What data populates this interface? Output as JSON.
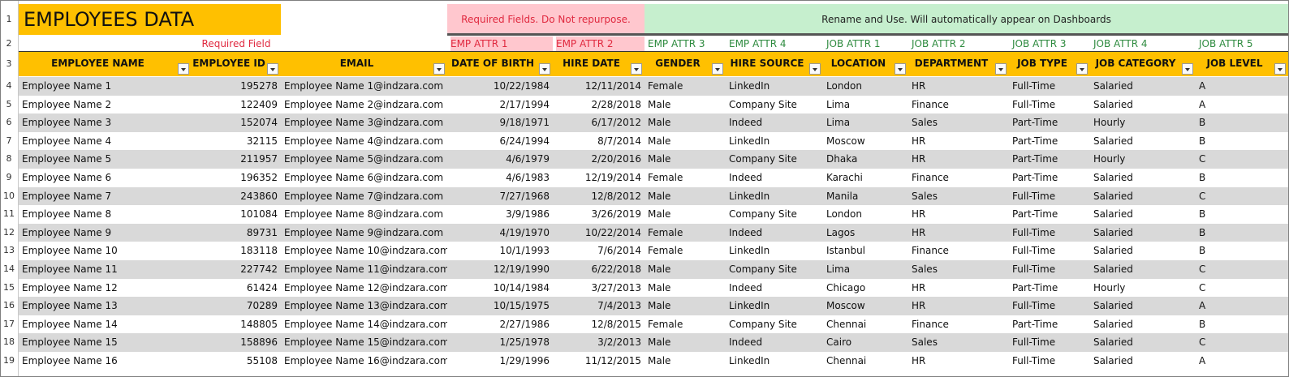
{
  "title": "EMPLOYEES DATA",
  "required_field_label": "Required Field",
  "banner_required": "Required Fields. Do Not repurpose.",
  "banner_rename": "Rename and Use. Will automatically appear on Dashboards",
  "colors": {
    "header_orange": "#ffc000",
    "required_pink": "#ffc7ce",
    "required_text": "#e0293f",
    "rename_green": "#c6efce",
    "green_text": "#2e8b3f",
    "row_gray": "#d9d9d9"
  },
  "icons": {
    "dropdown": "filter-dropdown-icon"
  },
  "attributes": [
    "EMP ATTR 1",
    "EMP ATTR 2",
    "EMP ATTR 3",
    "EMP ATTR 4",
    "JOB ATTR 1",
    "JOB ATTR 2",
    "JOB ATTR 3",
    "JOB ATTR 4",
    "JOB ATTR 5"
  ],
  "headers": [
    "EMPLOYEE NAME",
    "EMPLOYEE ID",
    "EMAIL",
    "DATE OF BIRTH",
    "HIRE DATE",
    "GENDER",
    "HIRE SOURCE",
    "LOCATION",
    "DEPARTMENT",
    "JOB TYPE",
    "JOB CATEGORY",
    "JOB LEVEL"
  ],
  "row_numbers": [
    "1",
    "2",
    "3",
    "4",
    "5",
    "6",
    "7",
    "8",
    "9",
    "10",
    "11",
    "12",
    "13",
    "14",
    "15",
    "16",
    "17",
    "18",
    "19"
  ],
  "rows": [
    [
      "Employee Name 1",
      "195278",
      "Employee Name 1@indzara.com",
      "10/22/1984",
      "12/11/2014",
      "Female",
      "LinkedIn",
      "London",
      "HR",
      "Full-Time",
      "Salaried",
      "A"
    ],
    [
      "Employee Name 2",
      "122409",
      "Employee Name 2@indzara.com",
      "2/17/1994",
      "2/28/2018",
      "Male",
      "Company Site",
      "Lima",
      "Finance",
      "Full-Time",
      "Salaried",
      "A"
    ],
    [
      "Employee Name 3",
      "152074",
      "Employee Name 3@indzara.com",
      "9/18/1971",
      "6/17/2012",
      "Male",
      "Indeed",
      "Lima",
      "Sales",
      "Part-Time",
      "Hourly",
      "B"
    ],
    [
      "Employee Name 4",
      "32115",
      "Employee Name 4@indzara.com",
      "6/24/1994",
      "8/7/2014",
      "Male",
      "LinkedIn",
      "Moscow",
      "HR",
      "Part-Time",
      "Salaried",
      "B"
    ],
    [
      "Employee Name 5",
      "211957",
      "Employee Name 5@indzara.com",
      "4/6/1979",
      "2/20/2016",
      "Male",
      "Company Site",
      "Dhaka",
      "HR",
      "Part-Time",
      "Hourly",
      "C"
    ],
    [
      "Employee Name 6",
      "196352",
      "Employee Name 6@indzara.com",
      "4/6/1983",
      "12/19/2014",
      "Female",
      "Indeed",
      "Karachi",
      "Finance",
      "Part-Time",
      "Salaried",
      "B"
    ],
    [
      "Employee Name 7",
      "243860",
      "Employee Name 7@indzara.com",
      "7/27/1968",
      "12/8/2012",
      "Male",
      "LinkedIn",
      "Manila",
      "Sales",
      "Full-Time",
      "Salaried",
      "C"
    ],
    [
      "Employee Name 8",
      "101084",
      "Employee Name 8@indzara.com",
      "3/9/1986",
      "3/26/2019",
      "Male",
      "Company Site",
      "London",
      "HR",
      "Part-Time",
      "Salaried",
      "B"
    ],
    [
      "Employee Name 9",
      "89731",
      "Employee Name 9@indzara.com",
      "4/19/1970",
      "10/22/2014",
      "Female",
      "Indeed",
      "Lagos",
      "HR",
      "Full-Time",
      "Salaried",
      "B"
    ],
    [
      "Employee Name 10",
      "183118",
      "Employee Name 10@indzara.com",
      "10/1/1993",
      "7/6/2014",
      "Female",
      "LinkedIn",
      "Istanbul",
      "Finance",
      "Full-Time",
      "Salaried",
      "B"
    ],
    [
      "Employee Name 11",
      "227742",
      "Employee Name 11@indzara.com",
      "12/19/1990",
      "6/22/2018",
      "Male",
      "Company Site",
      "Lima",
      "Sales",
      "Full-Time",
      "Salaried",
      "C"
    ],
    [
      "Employee Name 12",
      "61424",
      "Employee Name 12@indzara.com",
      "10/14/1984",
      "3/27/2013",
      "Male",
      "Indeed",
      "Chicago",
      "HR",
      "Part-Time",
      "Hourly",
      "C"
    ],
    [
      "Employee Name 13",
      "70289",
      "Employee Name 13@indzara.com",
      "10/15/1975",
      "7/4/2013",
      "Male",
      "LinkedIn",
      "Moscow",
      "HR",
      "Full-Time",
      "Salaried",
      "A"
    ],
    [
      "Employee Name 14",
      "148805",
      "Employee Name 14@indzara.com",
      "2/27/1986",
      "12/8/2015",
      "Female",
      "Company Site",
      "Chennai",
      "Finance",
      "Part-Time",
      "Salaried",
      "B"
    ],
    [
      "Employee Name 15",
      "158896",
      "Employee Name 15@indzara.com",
      "1/25/1978",
      "3/2/2013",
      "Male",
      "Indeed",
      "Cairo",
      "Sales",
      "Full-Time",
      "Salaried",
      "C"
    ],
    [
      "Employee Name 16",
      "55108",
      "Employee Name 16@indzara.com",
      "1/29/1996",
      "11/12/2015",
      "Male",
      "LinkedIn",
      "Chennai",
      "HR",
      "Full-Time",
      "Salaried",
      "A"
    ]
  ]
}
